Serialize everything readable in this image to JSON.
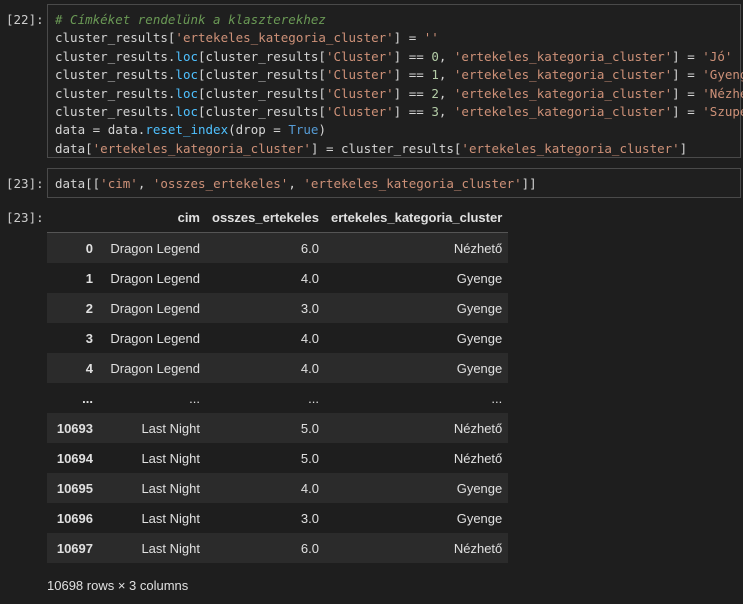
{
  "cell22": {
    "prompt": "[22]:",
    "lines": [
      [
        [
          "cm",
          "# Címkéket rendelünk a klaszterekhez"
        ]
      ],
      [
        [
          "id",
          "cluster_results"
        ],
        [
          "br",
          "["
        ],
        [
          "st",
          "'ertekeles_kategoria_cluster'"
        ],
        [
          "br",
          "]"
        ],
        [
          "op",
          " = "
        ],
        [
          "st",
          "''"
        ]
      ],
      [
        [
          "id",
          "cluster_results"
        ],
        [
          "op",
          "."
        ],
        [
          "mt",
          "loc"
        ],
        [
          "br",
          "[cluster_results["
        ],
        [
          "st",
          "'Cluster'"
        ],
        [
          "br",
          "]"
        ],
        [
          "op",
          " == "
        ],
        [
          "nm",
          "0"
        ],
        [
          "op",
          ", "
        ],
        [
          "st",
          "'ertekeles_kategoria_cluster'"
        ],
        [
          "br",
          "]"
        ],
        [
          "op",
          " = "
        ],
        [
          "st",
          "'Jó'"
        ]
      ],
      [
        [
          "id",
          "cluster_results"
        ],
        [
          "op",
          "."
        ],
        [
          "mt",
          "loc"
        ],
        [
          "br",
          "[cluster_results["
        ],
        [
          "st",
          "'Cluster'"
        ],
        [
          "br",
          "]"
        ],
        [
          "op",
          " == "
        ],
        [
          "nm",
          "1"
        ],
        [
          "op",
          ", "
        ],
        [
          "st",
          "'ertekeles_kategoria_cluster'"
        ],
        [
          "br",
          "]"
        ],
        [
          "op",
          " = "
        ],
        [
          "st",
          "'Gyenge'"
        ]
      ],
      [
        [
          "id",
          "cluster_results"
        ],
        [
          "op",
          "."
        ],
        [
          "mt",
          "loc"
        ],
        [
          "br",
          "[cluster_results["
        ],
        [
          "st",
          "'Cluster'"
        ],
        [
          "br",
          "]"
        ],
        [
          "op",
          " == "
        ],
        [
          "nm",
          "2"
        ],
        [
          "op",
          ", "
        ],
        [
          "st",
          "'ertekeles_kategoria_cluster'"
        ],
        [
          "br",
          "]"
        ],
        [
          "op",
          " = "
        ],
        [
          "st",
          "'Nézhető'"
        ]
      ],
      [
        [
          "id",
          "cluster_results"
        ],
        [
          "op",
          "."
        ],
        [
          "mt",
          "loc"
        ],
        [
          "br",
          "[cluster_results["
        ],
        [
          "st",
          "'Cluster'"
        ],
        [
          "br",
          "]"
        ],
        [
          "op",
          " == "
        ],
        [
          "nm",
          "3"
        ],
        [
          "op",
          ", "
        ],
        [
          "st",
          "'ertekeles_kategoria_cluster'"
        ],
        [
          "br",
          "]"
        ],
        [
          "op",
          " = "
        ],
        [
          "st",
          "'Szuper'"
        ]
      ],
      [
        [
          "id",
          "data"
        ],
        [
          "op",
          " = "
        ],
        [
          "id",
          "data"
        ],
        [
          "op",
          "."
        ],
        [
          "mt",
          "reset_index"
        ],
        [
          "br",
          "("
        ],
        [
          "id",
          "drop"
        ],
        [
          "op",
          " = "
        ],
        [
          "kw",
          "True"
        ],
        [
          "br",
          ")"
        ]
      ],
      [
        [
          "id",
          "data"
        ],
        [
          "br",
          "["
        ],
        [
          "st",
          "'ertekeles_kategoria_cluster'"
        ],
        [
          "br",
          "]"
        ],
        [
          "op",
          " = "
        ],
        [
          "id",
          "cluster_results"
        ],
        [
          "br",
          "["
        ],
        [
          "st",
          "'ertekeles_kategoria_cluster'"
        ],
        [
          "br",
          "]"
        ]
      ]
    ]
  },
  "cell23": {
    "prompt": "[23]:",
    "lines": [
      [
        [
          "id",
          "data"
        ],
        [
          "br",
          "[["
        ],
        [
          "st",
          "'cim'"
        ],
        [
          "op",
          ", "
        ],
        [
          "st",
          "'osszes_ertekeles'"
        ],
        [
          "op",
          ", "
        ],
        [
          "st",
          "'ertekeles_kategoria_cluster'"
        ],
        [
          "br",
          "]]"
        ]
      ]
    ]
  },
  "out23": {
    "prompt": "[23]:",
    "columns": [
      "cim",
      "osszes_ertekeles",
      "ertekeles_kategoria_cluster"
    ],
    "rows": [
      {
        "idx": "0",
        "cim": "Dragon Legend",
        "osszes": "6.0",
        "kat": "Nézhető"
      },
      {
        "idx": "1",
        "cim": "Dragon Legend",
        "osszes": "4.0",
        "kat": "Gyenge"
      },
      {
        "idx": "2",
        "cim": "Dragon Legend",
        "osszes": "3.0",
        "kat": "Gyenge"
      },
      {
        "idx": "3",
        "cim": "Dragon Legend",
        "osszes": "4.0",
        "kat": "Gyenge"
      },
      {
        "idx": "4",
        "cim": "Dragon Legend",
        "osszes": "4.0",
        "kat": "Gyenge"
      },
      {
        "idx": "...",
        "cim": "...",
        "osszes": "...",
        "kat": "..."
      },
      {
        "idx": "10693",
        "cim": "Last Night",
        "osszes": "5.0",
        "kat": "Nézhető"
      },
      {
        "idx": "10694",
        "cim": "Last Night",
        "osszes": "5.0",
        "kat": "Nézhető"
      },
      {
        "idx": "10695",
        "cim": "Last Night",
        "osszes": "4.0",
        "kat": "Gyenge"
      },
      {
        "idx": "10696",
        "cim": "Last Night",
        "osszes": "3.0",
        "kat": "Gyenge"
      },
      {
        "idx": "10697",
        "cim": "Last Night",
        "osszes": "6.0",
        "kat": "Nézhető"
      }
    ],
    "footer": "10698 rows × 3 columns"
  }
}
